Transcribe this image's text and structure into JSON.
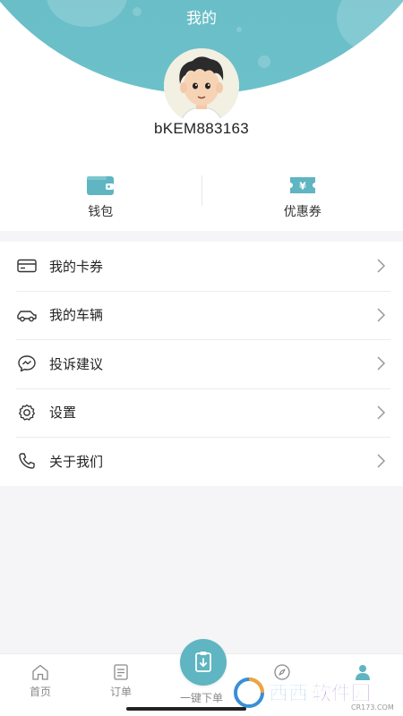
{
  "header": {
    "title": "我的"
  },
  "profile": {
    "username": "bKEM883163"
  },
  "quick_actions": [
    {
      "label": "钱包",
      "icon": "wallet-icon"
    },
    {
      "label": "优惠券",
      "icon": "coupon-icon"
    }
  ],
  "menu": {
    "items": [
      {
        "label": "我的卡券",
        "icon": "card-icon"
      },
      {
        "label": "我的车辆",
        "icon": "car-icon"
      },
      {
        "label": "投诉建议",
        "icon": "chat-bubble-icon"
      },
      {
        "label": "设置",
        "icon": "gear-icon"
      },
      {
        "label": "关于我们",
        "icon": "phone-icon"
      }
    ]
  },
  "tabbar": {
    "items": [
      {
        "label": "首页",
        "icon": "home-icon"
      },
      {
        "label": "订单",
        "icon": "order-icon"
      },
      {
        "label": "一键下单",
        "icon": "quick-order-icon"
      },
      {
        "label": "",
        "icon": "compass-icon"
      },
      {
        "label": "",
        "icon": "profile-icon"
      }
    ]
  },
  "watermark": {
    "brand": "西西软件园",
    "domain": "CR173.COM"
  },
  "colors": {
    "accent": "#5fb5c1",
    "header": "#62b9c4"
  }
}
